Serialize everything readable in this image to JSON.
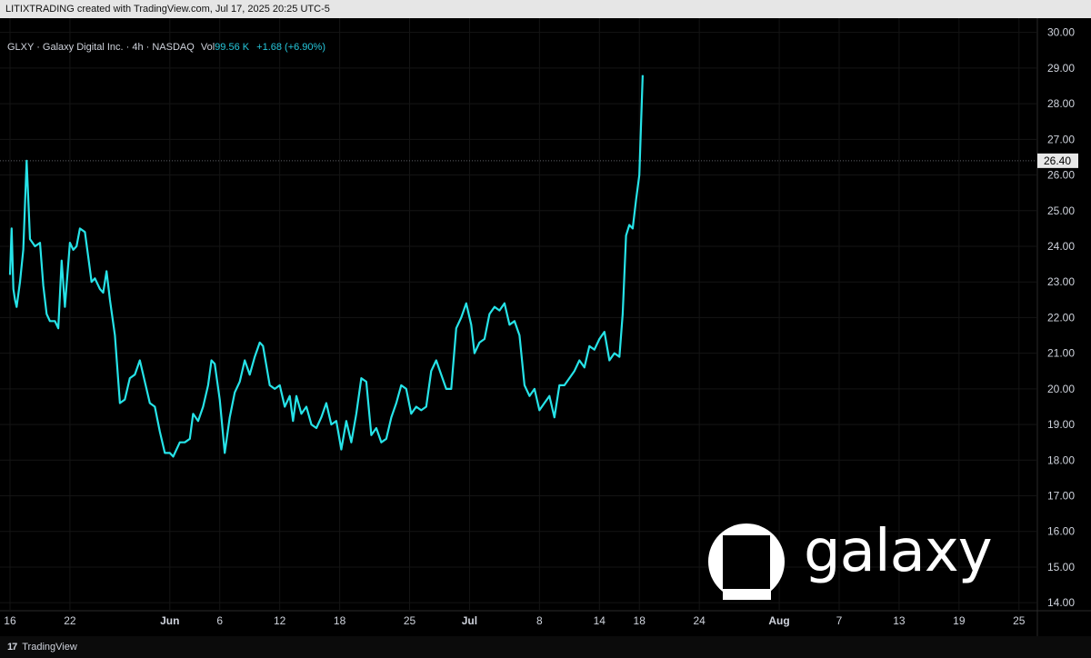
{
  "header": {
    "attribution": "LITIXTRADING created with TradingView.com, Jul 17, 2025 20:25 UTC-5"
  },
  "legend": {
    "symbol_text": "GLXY · Galaxy Digital Inc. · 4h · NASDAQ",
    "vol_label": "Vol",
    "vol_value": "99.56 K",
    "change": "+1.68 (+6.90%)"
  },
  "footer": {
    "brand": "TradingView",
    "logo_glyph": "17"
  },
  "watermark": {
    "wordmark": "galaxy"
  },
  "colors": {
    "line": "#26e3e8",
    "background": "#000000",
    "grid": "#141414",
    "price_label_bg": "#e8e8e8"
  },
  "chart_data": {
    "type": "line",
    "title": "",
    "xlabel": "",
    "ylabel": "",
    "ylim": [
      13.8,
      30.4
    ],
    "y_ticks": [
      "14.00",
      "15.00",
      "16.00",
      "17.00",
      "18.00",
      "19.00",
      "20.00",
      "21.00",
      "22.00",
      "23.00",
      "24.00",
      "25.00",
      "26.00",
      "27.00",
      "28.00",
      "29.00",
      "30.00"
    ],
    "x_ticks": [
      {
        "label": "16",
        "date": "2025-05-16",
        "bold": false
      },
      {
        "label": "22",
        "date": "2025-05-22",
        "bold": false
      },
      {
        "label": "Jun",
        "date": "2025-06-01",
        "bold": true
      },
      {
        "label": "6",
        "date": "2025-06-06",
        "bold": false
      },
      {
        "label": "12",
        "date": "2025-06-12",
        "bold": false
      },
      {
        "label": "18",
        "date": "2025-06-18",
        "bold": false
      },
      {
        "label": "25",
        "date": "2025-06-25",
        "bold": false
      },
      {
        "label": "Jul",
        "date": "2025-07-01",
        "bold": true
      },
      {
        "label": "8",
        "date": "2025-07-08",
        "bold": false
      },
      {
        "label": "14",
        "date": "2025-07-14",
        "bold": false
      },
      {
        "label": "18",
        "date": "2025-07-18",
        "bold": false
      },
      {
        "label": "24",
        "date": "2025-07-24",
        "bold": false
      },
      {
        "label": "Aug",
        "date": "2025-08-01",
        "bold": true
      },
      {
        "label": "7",
        "date": "2025-08-07",
        "bold": false
      },
      {
        "label": "13",
        "date": "2025-08-13",
        "bold": false
      },
      {
        "label": "19",
        "date": "2025-08-19",
        "bold": false
      },
      {
        "label": "25",
        "date": "2025-08-25",
        "bold": false
      }
    ],
    "x_range": [
      "2025-05-15",
      "2025-08-26T18:00"
    ],
    "current_price": {
      "value": 26.4,
      "label": "26.40"
    },
    "series": [
      {
        "points": [
          [
            "2025-05-16T00:00",
            23.2
          ],
          [
            "2025-05-16T04:00",
            24.5
          ],
          [
            "2025-05-16T08:00",
            22.8
          ],
          [
            "2025-05-16T12:00",
            22.5
          ],
          [
            "2025-05-16T16:00",
            22.3
          ],
          [
            "2025-05-17T00:00",
            23.0
          ],
          [
            "2025-05-17T08:00",
            23.9
          ],
          [
            "2025-05-17T16:00",
            26.4
          ],
          [
            "2025-05-18T00:00",
            24.2
          ],
          [
            "2025-05-18T12:00",
            24.0
          ],
          [
            "2025-05-19T00:00",
            24.1
          ],
          [
            "2025-05-19T08:00",
            22.9
          ],
          [
            "2025-05-19T16:00",
            22.1
          ],
          [
            "2025-05-20T00:00",
            21.9
          ],
          [
            "2025-05-20T12:00",
            21.9
          ],
          [
            "2025-05-20T20:00",
            21.7
          ],
          [
            "2025-05-21T04:00",
            23.6
          ],
          [
            "2025-05-21T12:00",
            22.3
          ],
          [
            "2025-05-22T00:00",
            24.1
          ],
          [
            "2025-05-22T08:00",
            23.9
          ],
          [
            "2025-05-22T16:00",
            24.0
          ],
          [
            "2025-05-23T00:00",
            24.5
          ],
          [
            "2025-05-23T12:00",
            24.4
          ],
          [
            "2025-05-23T20:00",
            23.7
          ],
          [
            "2025-05-24T04:00",
            23.0
          ],
          [
            "2025-05-24T12:00",
            23.1
          ],
          [
            "2025-05-25T00:00",
            22.8
          ],
          [
            "2025-05-25T08:00",
            22.7
          ],
          [
            "2025-05-25T16:00",
            23.3
          ],
          [
            "2025-05-26T00:00",
            22.5
          ],
          [
            "2025-05-26T12:00",
            21.5
          ],
          [
            "2025-05-27T00:00",
            19.6
          ],
          [
            "2025-05-27T12:00",
            19.7
          ],
          [
            "2025-05-28T00:00",
            20.3
          ],
          [
            "2025-05-28T12:00",
            20.4
          ],
          [
            "2025-05-29T00:00",
            20.8
          ],
          [
            "2025-05-29T12:00",
            20.2
          ],
          [
            "2025-05-30T00:00",
            19.6
          ],
          [
            "2025-05-30T12:00",
            19.5
          ],
          [
            "2025-05-31T00:00",
            18.8
          ],
          [
            "2025-05-31T12:00",
            18.2
          ],
          [
            "2025-06-01T00:00",
            18.2
          ],
          [
            "2025-06-01T08:00",
            18.1
          ],
          [
            "2025-06-02T00:00",
            18.5
          ],
          [
            "2025-06-02T12:00",
            18.5
          ],
          [
            "2025-06-03T00:00",
            18.6
          ],
          [
            "2025-06-03T08:00",
            19.3
          ],
          [
            "2025-06-03T20:00",
            19.1
          ],
          [
            "2025-06-04T08:00",
            19.5
          ],
          [
            "2025-06-04T20:00",
            20.1
          ],
          [
            "2025-06-05T04:00",
            20.8
          ],
          [
            "2025-06-05T12:00",
            20.7
          ],
          [
            "2025-06-06T00:00",
            19.7
          ],
          [
            "2025-06-06T12:00",
            18.2
          ],
          [
            "2025-06-07T00:00",
            19.2
          ],
          [
            "2025-06-07T12:00",
            19.9
          ],
          [
            "2025-06-08T00:00",
            20.2
          ],
          [
            "2025-06-08T12:00",
            20.8
          ],
          [
            "2025-06-09T00:00",
            20.4
          ],
          [
            "2025-06-09T12:00",
            20.9
          ],
          [
            "2025-06-10T00:00",
            21.3
          ],
          [
            "2025-06-10T08:00",
            21.2
          ],
          [
            "2025-06-11T00:00",
            20.1
          ],
          [
            "2025-06-11T12:00",
            20.0
          ],
          [
            "2025-06-12T00:00",
            20.1
          ],
          [
            "2025-06-12T12:00",
            19.5
          ],
          [
            "2025-06-13T00:00",
            19.8
          ],
          [
            "2025-06-13T08:00",
            19.1
          ],
          [
            "2025-06-13T16:00",
            19.8
          ],
          [
            "2025-06-14T04:00",
            19.3
          ],
          [
            "2025-06-14T16:00",
            19.5
          ],
          [
            "2025-06-15T04:00",
            19.0
          ],
          [
            "2025-06-15T16:00",
            18.9
          ],
          [
            "2025-06-16T04:00",
            19.2
          ],
          [
            "2025-06-16T16:00",
            19.6
          ],
          [
            "2025-06-17T04:00",
            19.0
          ],
          [
            "2025-06-17T16:00",
            19.1
          ],
          [
            "2025-06-18T04:00",
            18.3
          ],
          [
            "2025-06-18T16:00",
            19.1
          ],
          [
            "2025-06-19T04:00",
            18.5
          ],
          [
            "2025-06-19T16:00",
            19.3
          ],
          [
            "2025-06-20T04:00",
            20.3
          ],
          [
            "2025-06-20T16:00",
            20.2
          ],
          [
            "2025-06-21T04:00",
            18.7
          ],
          [
            "2025-06-21T16:00",
            18.9
          ],
          [
            "2025-06-22T04:00",
            18.5
          ],
          [
            "2025-06-22T16:00",
            18.6
          ],
          [
            "2025-06-23T04:00",
            19.2
          ],
          [
            "2025-06-23T16:00",
            19.6
          ],
          [
            "2025-06-24T04:00",
            20.1
          ],
          [
            "2025-06-24T16:00",
            20.0
          ],
          [
            "2025-06-25T04:00",
            19.3
          ],
          [
            "2025-06-25T16:00",
            19.5
          ],
          [
            "2025-06-26T04:00",
            19.4
          ],
          [
            "2025-06-26T16:00",
            19.5
          ],
          [
            "2025-06-27T04:00",
            20.5
          ],
          [
            "2025-06-27T16:00",
            20.8
          ],
          [
            "2025-06-28T04:00",
            20.4
          ],
          [
            "2025-06-28T16:00",
            20.0
          ],
          [
            "2025-06-29T04:00",
            20.0
          ],
          [
            "2025-06-29T16:00",
            21.7
          ],
          [
            "2025-06-30T04:00",
            22.0
          ],
          [
            "2025-06-30T16:00",
            22.4
          ],
          [
            "2025-07-01T04:00",
            21.8
          ],
          [
            "2025-07-01T12:00",
            21.0
          ],
          [
            "2025-07-02T00:00",
            21.3
          ],
          [
            "2025-07-02T12:00",
            21.4
          ],
          [
            "2025-07-03T00:00",
            22.1
          ],
          [
            "2025-07-03T12:00",
            22.3
          ],
          [
            "2025-07-04T00:00",
            22.2
          ],
          [
            "2025-07-04T12:00",
            22.4
          ],
          [
            "2025-07-05T00:00",
            21.8
          ],
          [
            "2025-07-05T12:00",
            21.9
          ],
          [
            "2025-07-06T00:00",
            21.5
          ],
          [
            "2025-07-06T12:00",
            20.1
          ],
          [
            "2025-07-07T00:00",
            19.8
          ],
          [
            "2025-07-07T12:00",
            20.0
          ],
          [
            "2025-07-08T00:00",
            19.4
          ],
          [
            "2025-07-08T12:00",
            19.6
          ],
          [
            "2025-07-09T00:00",
            19.8
          ],
          [
            "2025-07-09T12:00",
            19.2
          ],
          [
            "2025-07-10T00:00",
            20.1
          ],
          [
            "2025-07-10T12:00",
            20.1
          ],
          [
            "2025-07-11T00:00",
            20.3
          ],
          [
            "2025-07-11T12:00",
            20.5
          ],
          [
            "2025-07-12T00:00",
            20.8
          ],
          [
            "2025-07-12T12:00",
            20.6
          ],
          [
            "2025-07-13T00:00",
            21.2
          ],
          [
            "2025-07-13T12:00",
            21.1
          ],
          [
            "2025-07-14T00:00",
            21.4
          ],
          [
            "2025-07-14T12:00",
            21.6
          ],
          [
            "2025-07-15T00:00",
            20.8
          ],
          [
            "2025-07-15T12:00",
            21.0
          ],
          [
            "2025-07-16T00:00",
            20.9
          ],
          [
            "2025-07-16T08:00",
            22.1
          ],
          [
            "2025-07-16T16:00",
            24.3
          ],
          [
            "2025-07-17T00:00",
            24.6
          ],
          [
            "2025-07-17T08:00",
            24.5
          ],
          [
            "2025-07-17T16:00",
            25.3
          ],
          [
            "2025-07-18T00:00",
            26.0
          ],
          [
            "2025-07-18T08:00",
            28.8
          ]
        ]
      }
    ]
  }
}
